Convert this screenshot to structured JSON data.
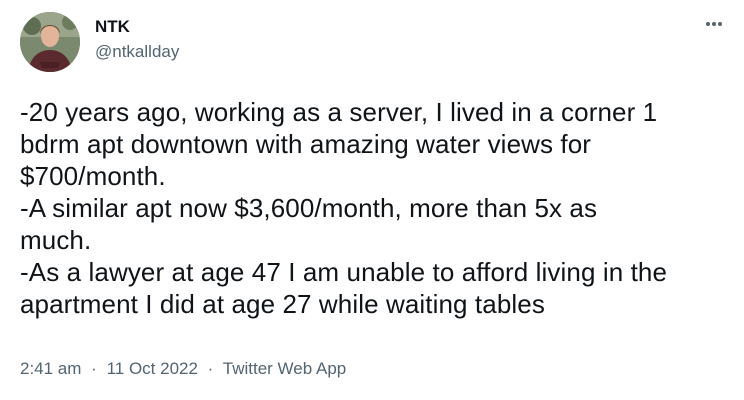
{
  "author": {
    "display_name": "NTK",
    "handle": "@ntkallday",
    "avatar_icon": "profile-photo"
  },
  "menu": {
    "icon": "more-horizontal-icon"
  },
  "tweet": {
    "lines": [
      "-20 years ago, working as a server, I lived in a corner 1",
      "bdrm apt downtown with amazing water views for",
      "$700/month.",
      "-A similar apt now $3,600/month, more than 5x as",
      "much.",
      "-As a lawyer at age 47 I am unable to afford living in the",
      "apartment I did at age 27 while waiting tables"
    ]
  },
  "meta": {
    "time": "2:41 am",
    "date": "11 Oct 2022",
    "separator": "·",
    "source": "Twitter Web App"
  },
  "colors": {
    "text": "#0f1419",
    "secondary": "#536471",
    "background": "#ffffff"
  }
}
